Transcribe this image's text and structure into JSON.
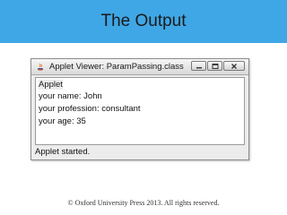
{
  "slide": {
    "title": "The Output",
    "footer": "© Oxford University Press 2013. All rights reserved.",
    "title_bar_color": "#3fa7e6"
  },
  "window": {
    "title": "Applet Viewer: ParamPassing.class",
    "icon": "java-icon",
    "controls": [
      "minimize-icon",
      "maximize-icon",
      "close-icon"
    ],
    "applet_label": "Applet",
    "lines": [
      "your name: John",
      "your profession: consultant",
      "your age: 35"
    ],
    "status": "Applet started."
  }
}
